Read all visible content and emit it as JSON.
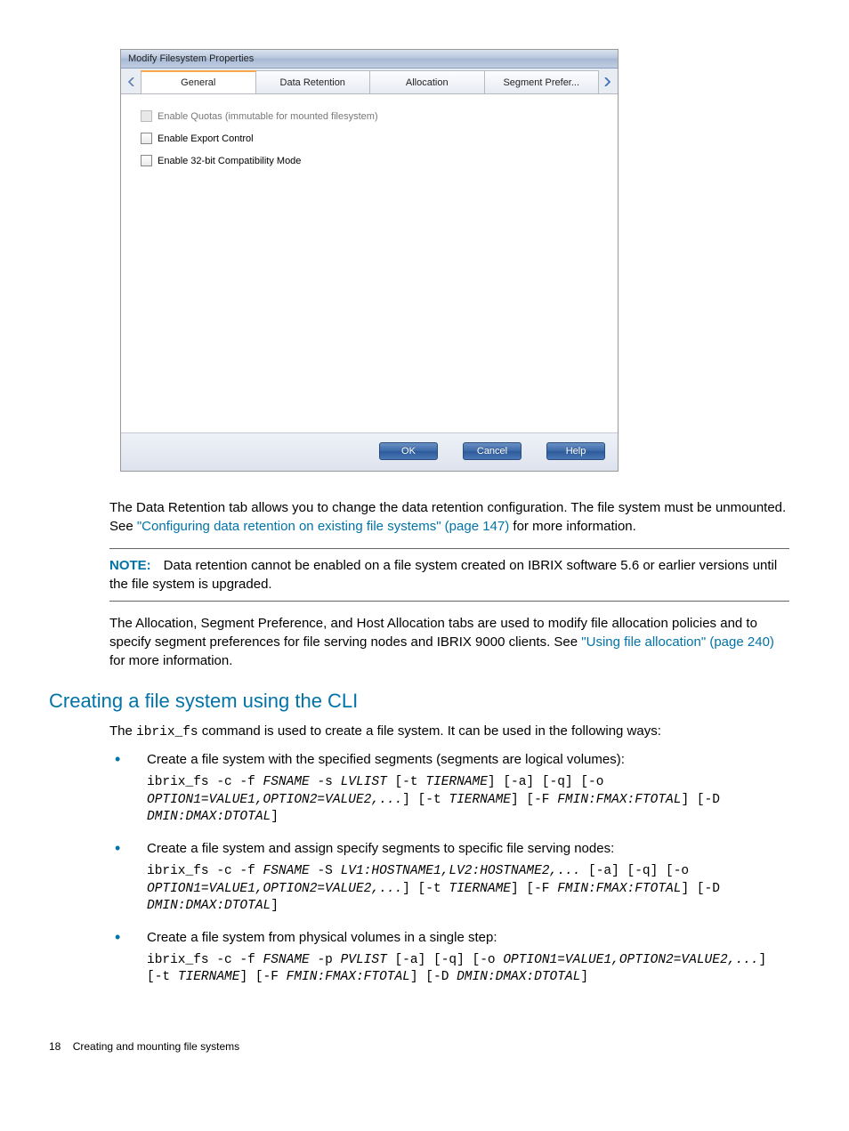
{
  "dialog": {
    "title": "Modify Filesystem Properties",
    "tabs": [
      "General",
      "Data Retention",
      "Allocation",
      "Segment Prefer..."
    ],
    "checkboxes": [
      {
        "label": "Enable Quotas (immutable for mounted filesystem)",
        "disabled": true
      },
      {
        "label": "Enable Export Control",
        "disabled": false
      },
      {
        "label": "Enable 32-bit Compatibility Mode",
        "disabled": false
      }
    ],
    "buttons": {
      "ok": "OK",
      "cancel": "Cancel",
      "help": "Help"
    }
  },
  "doc": {
    "para1a": "The Data Retention tab allows you to change the data retention configuration. The file system must be unmounted. See ",
    "link1": "\"Configuring data retention on existing file systems\" (page 147)",
    "para1b": " for more information.",
    "note_label": "NOTE:",
    "note_text": "Data retention cannot be enabled on a file system created on IBRIX software 5.6 or earlier versions until the file system is upgraded.",
    "para2a": "The Allocation, Segment Preference, and Host Allocation tabs are used to modify file allocation policies and to specify segment preferences for file serving nodes and IBRIX 9000 clients. See ",
    "link2": "\"Using file allocation\" (page 240)",
    "para2b": " for more information.",
    "heading": "Creating a file system using the CLI",
    "intro_a": "The ",
    "intro_cmd": "ibrix_fs",
    "intro_b": " command is used to create a file system. It can be used in the following ways:",
    "bullets": [
      {
        "text": "Create a file system with the specified segments (segments are logical volumes):",
        "code_html": "ibrix_fs -c -f <i>FSNAME</i> -s <i>LVLIST</i> [-t <i>TIERNAME</i>] [-a] [-q] [-o <i>OPTION1=VALUE1,OPTION2=VALUE2,...</i>] [-t <i>TIERNAME</i>] [-F <i>FMIN:FMAX:FTOTAL</i>] [-D <i>DMIN:DMAX:DTOTAL</i>]"
      },
      {
        "text": "Create a file system and assign specify segments to specific file serving nodes:",
        "code_html": "ibrix_fs -c -f <i>FSNAME</i> -S <i>LV1:HOSTNAME1,LV2:HOSTNAME2,...</i> [-a] [-q] [-o <i>OPTION1=VALUE1,OPTION2=VALUE2,...</i>] [-t <i>TIERNAME</i>] [-F <i>FMIN:FMAX:FTOTAL</i>] [-D <i>DMIN:DMAX:DTOTAL</i>]"
      },
      {
        "text": "Create a file system from physical volumes in a single step:",
        "code_html": "ibrix_fs -c -f <i>FSNAME</i> -p <i>PVLIST</i> [-a] [-q] [-o <i>OPTION1=VALUE1,OPTION2=VALUE2,...</i>] [-t <i>TIERNAME</i>] [-F <i>FMIN:FMAX:FTOTAL</i>] [-D <i>DMIN:DMAX:DTOTAL</i>]"
      }
    ],
    "footer_page": "18",
    "footer_text": "Creating and mounting file systems"
  }
}
